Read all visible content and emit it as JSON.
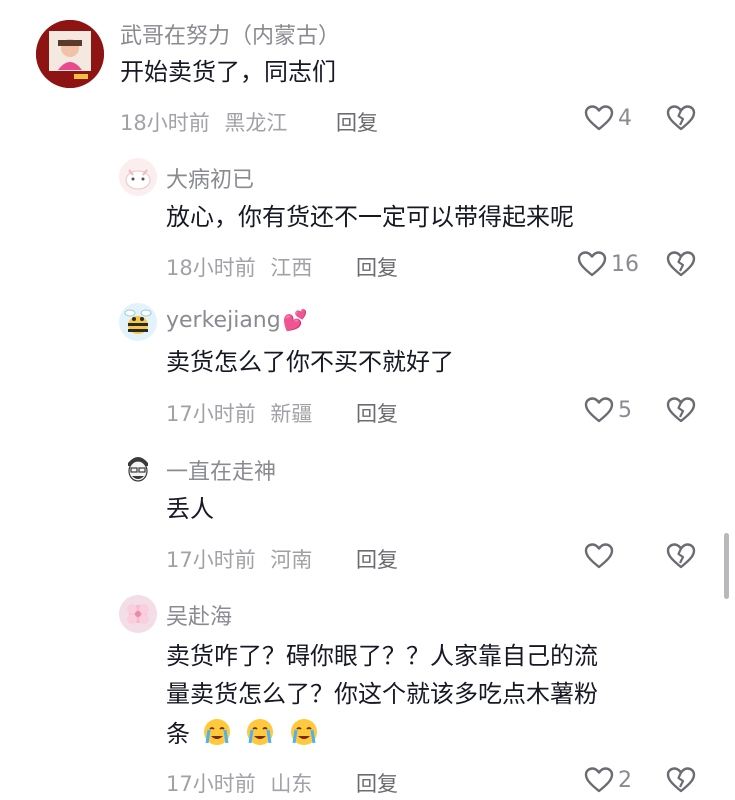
{
  "comments": [
    {
      "user": "武哥在努力（内蒙古）",
      "text": "开始卖货了，同志们",
      "time": "18小时前",
      "location": "黑龙江",
      "reply_label": "回复",
      "likes": "4"
    },
    {
      "user": "大病初已",
      "text": "放心，你有货还不一定可以带得起来呢",
      "time": "18小时前",
      "location": "江西",
      "reply_label": "回复",
      "likes": "16"
    },
    {
      "user": "yerkejiang",
      "user_emoji": "💕",
      "text": "卖货怎么了你不买不就好了",
      "time": "17小时前",
      "location": "新疆",
      "reply_label": "回复",
      "likes": "5"
    },
    {
      "user": "一直在走神",
      "text": "丢人",
      "time": "17小时前",
      "location": "河南",
      "reply_label": "回复",
      "likes": ""
    },
    {
      "user": "吴赴海",
      "text_line1": "卖货咋了？碍你眼了？？人家靠自己的流",
      "text_line2": "量卖货怎么了？你这个就该多吃点木薯粉",
      "text_line3": "条",
      "time": "17小时前",
      "location": "山东",
      "reply_label": "回复",
      "likes": "2"
    }
  ],
  "colors": {
    "text": "#161823",
    "secondary": "#8a8b91",
    "meta": "#a1a2a7",
    "emoji_heart": "#ff4fa3"
  }
}
